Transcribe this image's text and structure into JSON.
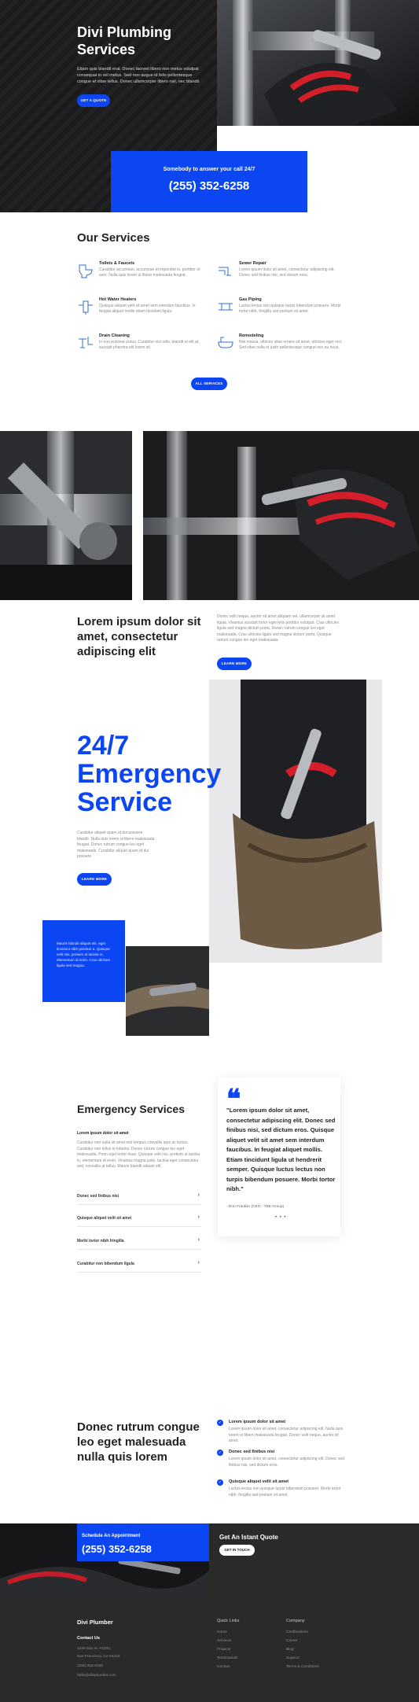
{
  "hero": {
    "title": "Divi Plumbing Services",
    "text": "Etiam quis blandit erat. Donec laoreet libero non metus volutpat consequat in vel metus. Sed non augue id felis pellentesque congue et vitae tellus. Donec ullamcorper libero nisl, nec blandit",
    "button": "GET A QUOTE"
  },
  "call": {
    "label": "Somebody to answer your call 24/7",
    "phone": "(255) 352-6258"
  },
  "services": {
    "title": "Our Services",
    "items": [
      {
        "name": "Toilets & Faucets",
        "desc": "Curabitur accumsan, accumsan et imperdiet in, porttitor et sem. Nulla quis lorem ut libero malesuada feugiat.",
        "icon": "toilet-icon"
      },
      {
        "name": "Sewer Repair",
        "desc": "Lorem ipsum dolor sit amet, consectetur adipiscing elit. Donec sed finibus nisi, sed dictum eros.",
        "icon": "pipe-icon"
      },
      {
        "name": "Hot Water Heaters",
        "desc": "Quisque aliquet velit sit amet sem interdum faucibus. In feugiat aliquet mollis etiam tincidunt ligula.",
        "icon": "water-heater-icon"
      },
      {
        "name": "Gas Piping",
        "desc": "Luctus lectus non quisque turpis bibendum posuere. Morbi tortor nibh, fringilla sed pretium sit amet.",
        "icon": "gas-pipe-icon"
      },
      {
        "name": "Drain Cleaning",
        "desc": "In non pulvinar purus. Curabitur nisi odio, blandit et elit at, suscipit pharetra elit lorem sit.",
        "icon": "drain-icon"
      },
      {
        "name": "Remodeling",
        "desc": "Nisi massa, ultrices vitae ornare sit amet, ultricies eget orci. Sed vitae nulla et justo pellentesque congue nec eu risus.",
        "icon": "bathtub-icon"
      }
    ],
    "button": "ALL SERVICES"
  },
  "lorem": {
    "title": "Lorem ipsum dolor sit amet, consectetur adipiscing elit",
    "text": "Donec velit neque, auctor sit amet aliquam vel, ullamcorper sit amet ligula. Vivamus suscipit tortor eget felis porttitor volutpat. Cras ultricies ligula sed magna dictum porta. Donec rutrum congue leo eget malesuada. Cras ultricies ligula sed magna dictum porta. Quisque rutrum congue leo eget malesuada.",
    "button": "LEARN MORE"
  },
  "emergency": {
    "title": "24/7 Emergency Service",
    "text": "Curabitur aliquet quam id dui posuere blandit. Nulla quis lorem ut libero malesuada feugiat. Donec rutrum congue leo eget malesuada. Curabitur aliquet quam id dui posuere.",
    "button": "LEARN MORE",
    "box_text": "Mauris blandit aliquet elit, eget tincidunt nibh pulvinar a. Quisque velit nisi, pretium ut lacinia in, elementum id enim. Cras ultricies ligula sed magna."
  },
  "emergency_services": {
    "title": "Emergency Services",
    "subtitle": "Lorem ipsum dolor sit amet",
    "text": "Curabitur non nulla sit amet nisl tempus convallis quis ac lectus. Curabitur non tellus in lobortis. Donec rutrum congue leo eget malesuada. Proin eget tortor risus. Quisque velit nisi, pretium ut lacinia in, elementum id enim. Vivamus magna justo, lacinia eget consectetur sed, convallis at tellus. Mauris blandit aliquet elit.",
    "accordion": [
      "Donec sed finibus nisi",
      "Quisque aliquet velit sit amet",
      "Morbi tortor nibh fringilla",
      "Curabitur non bibendum ligula"
    ],
    "testimonial": {
      "quote_mark": "❝",
      "quote": "\"Lorem ipsum dolor sit amet, consectetur adipiscing elit. Donec sed finibus nisi, sed dictum eros. Quisque aliquet velit sit amet sem interdum faucibus. In feugiat aliquet mollis. Etiam tincidunt ligula ut hendrerit semper. Quisque luctus lectus non turpis bibendum posuere. Morbi tortor nibh.\"",
      "author": "- Ron Franklin (CEO - TBE Group)",
      "dots": "• • •"
    }
  },
  "donec": {
    "title": "Donec rutrum congue leo eget malesuada nulla quis lorem",
    "items": [
      {
        "title": "Lorem ipsum dolor sit amet",
        "desc": "Lorem ipsum dolor sit amet, consectetur adipiscing elit. Nulla quis lorem ut libero malesuada feugiat. Donec velit neque, auctor sit amet."
      },
      {
        "title": "Donec sed finibus nisi",
        "desc": "Lorem ipsum dolor sit amet, consectetur adipiscing elit. Donec sed finibus nisi, sed dictum eros."
      },
      {
        "title": "Quisque aliquet velit sit amet",
        "desc": "Luctus lectus non quisque turpis bibendum posuere. Morbi tortor nibh, fringilla sed pretium sit amet."
      }
    ]
  },
  "cta": {
    "schedule": "Schedule An Appointment",
    "phone": "(255) 352-6258",
    "quote_head": "Get An Istant Quote",
    "button": "GET IN TOUCH"
  },
  "footer": {
    "brand": "Divi Plumber",
    "contact_head": "Contact Us",
    "contact_lines": [
      "1234 Divi St. #1000,",
      "San Francisco, CA 94220",
      "(255) 352-6258",
      "hello@diviplumber.com"
    ],
    "col1_head": "Quick Links",
    "col1_links": [
      "Home",
      "Services",
      "Projects",
      "Testimonials",
      "Contact"
    ],
    "col2_head": "Company",
    "col2_links": [
      "Certifications",
      "Career",
      "Blog",
      "Support",
      "Terms & Conditions"
    ]
  },
  "colors": {
    "accent": "#0c45f2",
    "dark": "#1b1b1d",
    "footer": "#2a2a2b"
  }
}
